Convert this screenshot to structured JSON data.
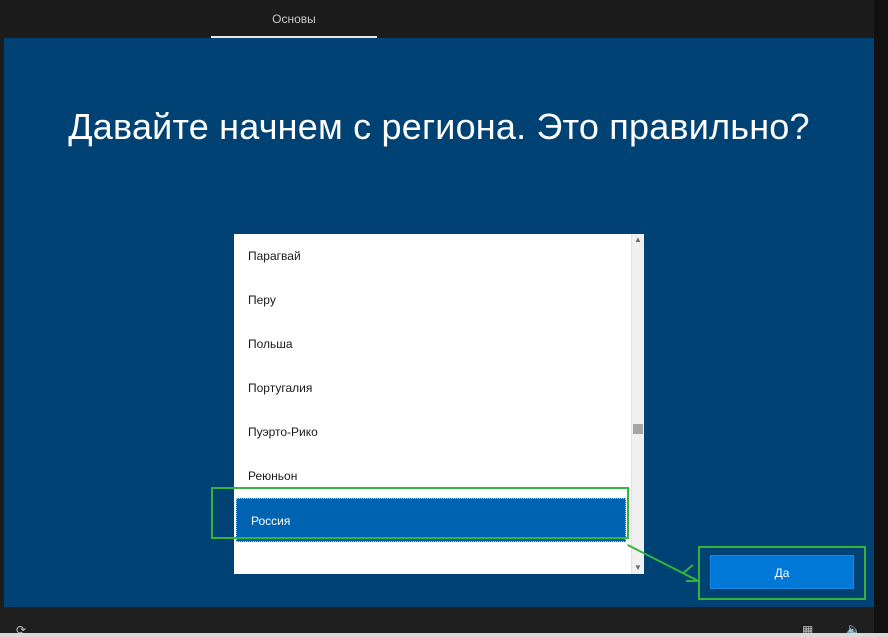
{
  "header": {
    "tab_label": "Основы"
  },
  "main": {
    "heading": "Давайте начнем с региона. Это правильно?"
  },
  "region_list": {
    "items": [
      {
        "label": "Парагвай",
        "selected": false
      },
      {
        "label": "Перу",
        "selected": false
      },
      {
        "label": "Польша",
        "selected": false
      },
      {
        "label": "Португалия",
        "selected": false
      },
      {
        "label": "Пуэрто-Рико",
        "selected": false
      },
      {
        "label": "Реюньон",
        "selected": false
      },
      {
        "label": "Россия",
        "selected": true
      }
    ],
    "scroll_position_fraction": 0.62
  },
  "actions": {
    "yes_label": "Да"
  },
  "taskbar": {
    "icons": [
      "accessibility-icon",
      "keyboard-icon",
      "speaker-icon"
    ]
  },
  "colors": {
    "background": "#004274",
    "selected": "#0063b1",
    "button": "#0078d7",
    "annotation": "#33b43c"
  }
}
